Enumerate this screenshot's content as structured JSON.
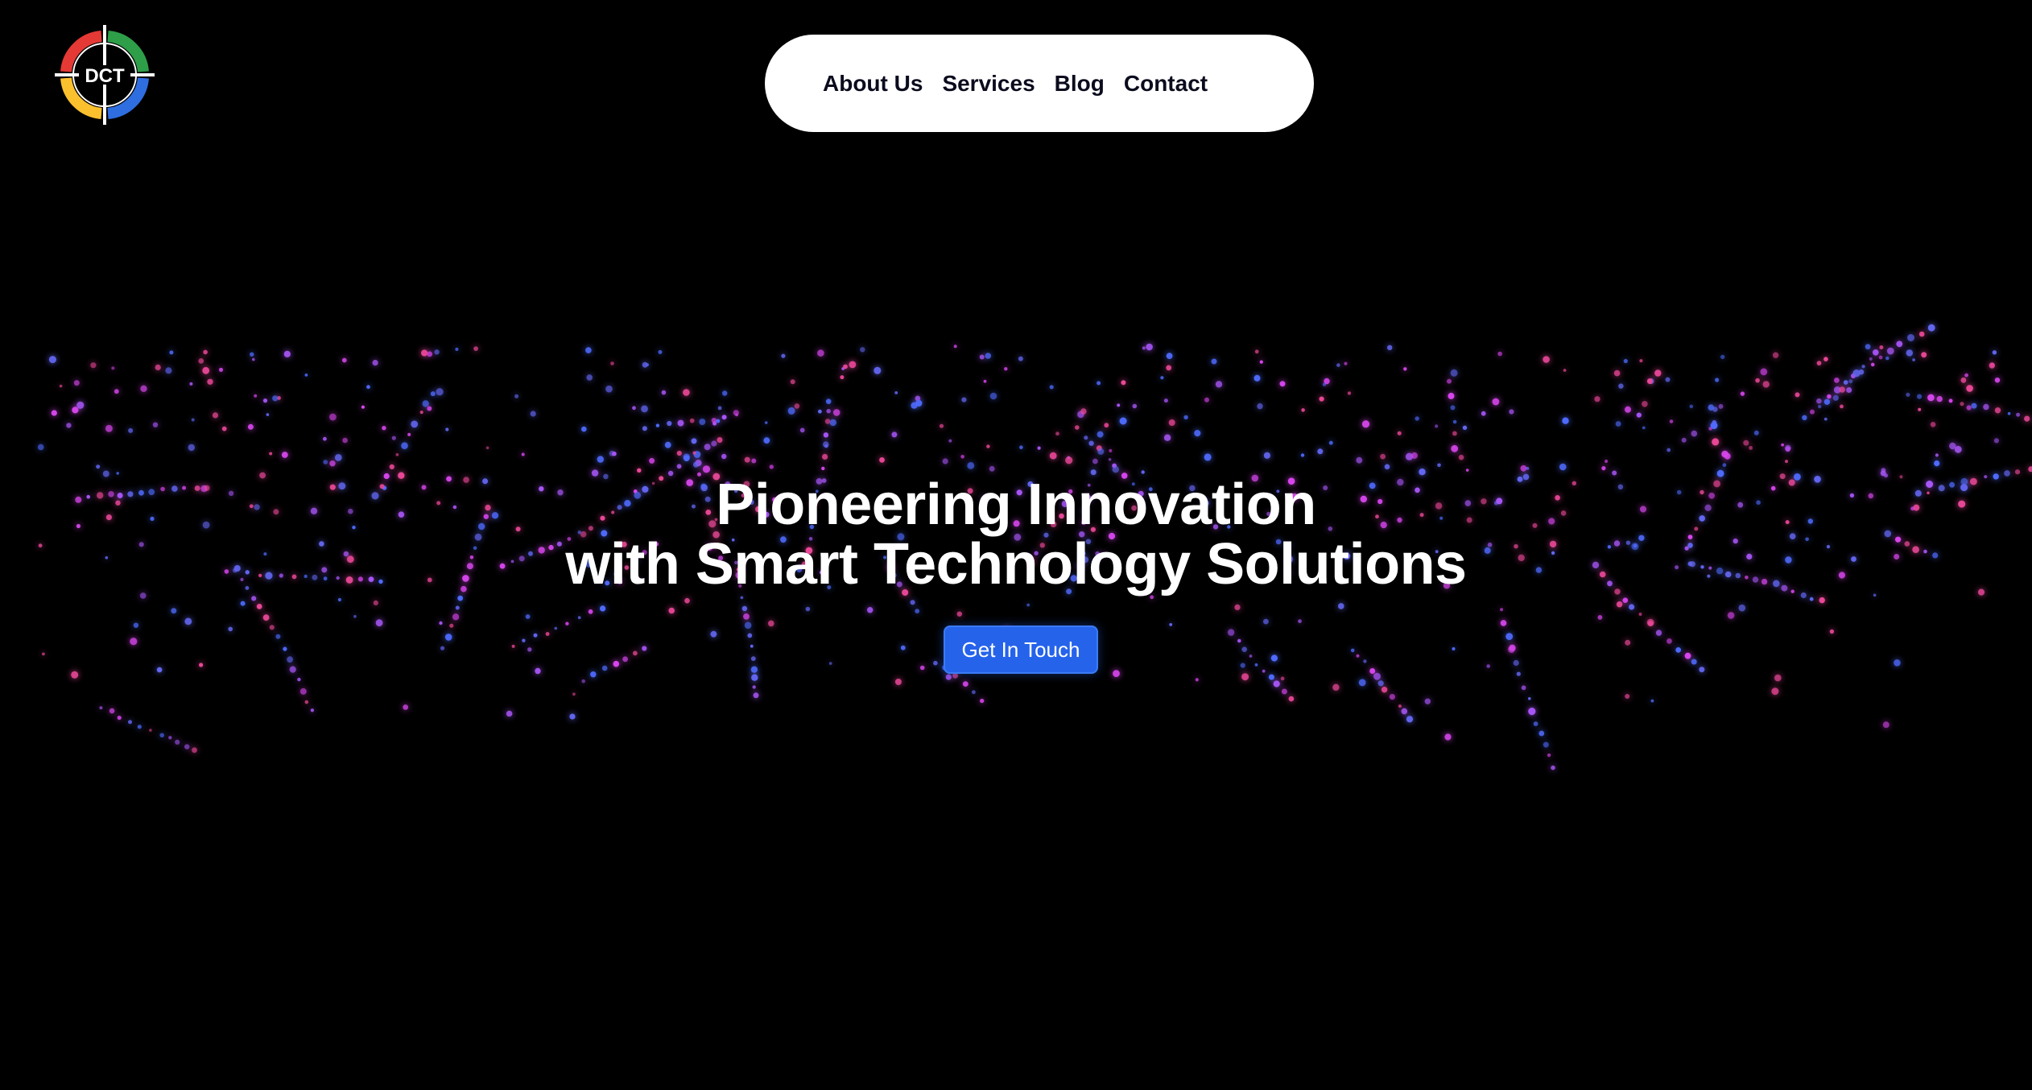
{
  "logo": {
    "text": "DCT",
    "colors": [
      "#e53935",
      "#2e9e49",
      "#fbc02d",
      "#2f6ee0"
    ]
  },
  "nav": {
    "items": [
      {
        "label": "About Us"
      },
      {
        "label": "Services"
      },
      {
        "label": "Blog"
      },
      {
        "label": "Contact"
      }
    ]
  },
  "hero": {
    "title_line1": "Pioneering Innovation",
    "title_line2": "with Smart Technology Solutions",
    "cta_label": "Get In Touch"
  },
  "colors": {
    "background": "#000000",
    "nav_background": "#ffffff",
    "cta": "#2563eb",
    "particle_magenta": "#d946ef",
    "particle_blue": "#4f6bff"
  }
}
